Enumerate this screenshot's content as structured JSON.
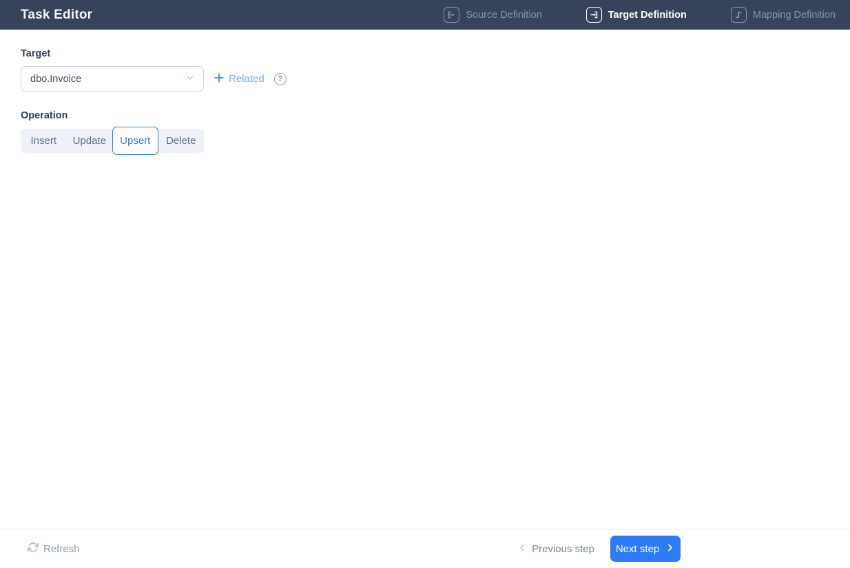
{
  "header": {
    "title": "Task Editor",
    "nav": [
      {
        "label": "Source Definition",
        "icon": "source-definition-icon",
        "active": false
      },
      {
        "label": "Target Definition",
        "icon": "target-definition-icon",
        "active": true
      },
      {
        "label": "Mapping Definition",
        "icon": "mapping-definition-icon",
        "active": false
      }
    ]
  },
  "form": {
    "target_label": "Target",
    "target_select": {
      "value": "dbo.Invoice"
    },
    "related_label": "Related",
    "operation_label": "Operation",
    "operations": [
      "Insert",
      "Update",
      "Upsert",
      "Delete"
    ],
    "selected_operation": "Upsert"
  },
  "footer": {
    "refresh_label": "Refresh",
    "previous_label": "Previous step",
    "next_label": "Next step"
  },
  "colors": {
    "header_bg": "#36435a",
    "header_inactive_text": "#8396b4",
    "header_active_text": "#ffffff",
    "accent_blue": "#2e7cf5",
    "link_blue": "#82a7f0",
    "label_dark": "#2e3e57",
    "segment_text": "#5d6f8a",
    "segment_track_bg": "#eef1f5",
    "select_border": "#c8d4e4",
    "footer_divider": "#e0eaf4",
    "footer_muted_text": "#8b9bb3"
  }
}
